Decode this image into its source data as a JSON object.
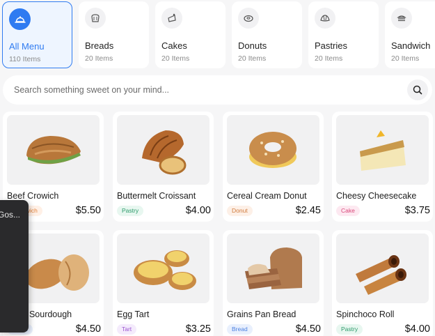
{
  "categories": [
    {
      "label": "All Menu",
      "count": "110 Items",
      "icon": "cloche-icon",
      "active": true
    },
    {
      "label": "Breads",
      "count": "20 Items",
      "icon": "bread-icon",
      "active": false
    },
    {
      "label": "Cakes",
      "count": "20 Items",
      "icon": "cake-icon",
      "active": false
    },
    {
      "label": "Donuts",
      "count": "20 Items",
      "icon": "donut-icon",
      "active": false
    },
    {
      "label": "Pastries",
      "count": "20 Items",
      "icon": "pastry-icon",
      "active": false
    },
    {
      "label": "Sandwich",
      "count": "20 Items",
      "icon": "sandwich-icon",
      "active": false
    }
  ],
  "search": {
    "placeholder": "Search something sweet on your mind...",
    "icon": "search-icon"
  },
  "products": [
    {
      "name": "Beef Crowich",
      "tag": "Sandwich",
      "price": "$5.50",
      "image": "crowich"
    },
    {
      "name": "Buttermelt Croissant",
      "tag": "Pastry",
      "price": "$4.00",
      "image": "croissant"
    },
    {
      "name": "Cereal Cream Donut",
      "tag": "Donut",
      "price": "$2.45",
      "image": "donut"
    },
    {
      "name": "Cheesy Cheesecake",
      "tag": "Cake",
      "price": "$3.75",
      "image": "cheesecake"
    },
    {
      "name": "Cozy Sourdough",
      "tag": "Bread",
      "price": "$4.50",
      "image": "sourdough"
    },
    {
      "name": "Egg Tart",
      "tag": "Tart",
      "price": "$3.25",
      "image": "eggtart"
    },
    {
      "name": "Grains Pan Bread",
      "tag": "Bread",
      "price": "$4.50",
      "image": "panbread"
    },
    {
      "name": "Spinchoco Roll",
      "tag": "Pastry",
      "price": "$4.00",
      "image": "roll"
    }
  ],
  "overlay": {
    "text": "Gos..."
  },
  "colors": {
    "accent": "#2f7bf1",
    "background": "#f6f6f7",
    "overlay": "#2a2a2c"
  }
}
